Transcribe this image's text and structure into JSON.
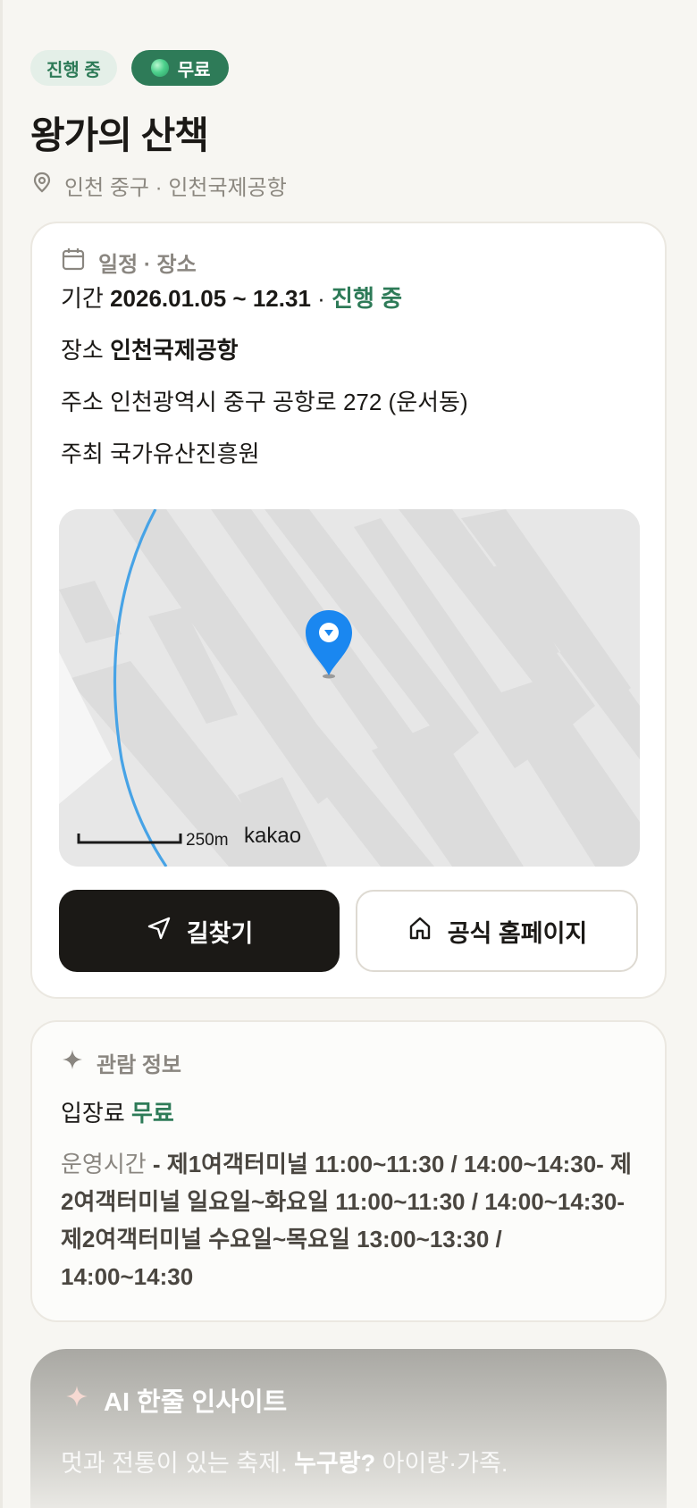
{
  "badges": {
    "status": "진행 중",
    "free": "무료"
  },
  "title": "왕가의 산책",
  "location": "인천 중구 · 인천국제공항",
  "schedule": {
    "heading": "일정 · 장소",
    "period_label": "기간",
    "period_value": "2026.01.05 ~ 12.31",
    "period_sep": "·",
    "period_status": "진행 중",
    "venue_label": "장소",
    "venue_value": "인천국제공항",
    "address_label": "주소",
    "address_value": "인천광역시 중구 공항로 272 (운서동)",
    "host_label": "주최",
    "host_value": "국가유산진흥원"
  },
  "map": {
    "scale_label": "250m",
    "brand": "kakao"
  },
  "actions": {
    "directions": "길찾기",
    "homepage": "공식 홈페이지"
  },
  "viewing": {
    "heading": "관람 정보",
    "fee_label": "입장료",
    "fee_value": "무료",
    "hours_label": "운영시간",
    "hours_value": "- 제1여객터미널 11:00~11:30 / 14:00~14:30- 제2여객터미널 일요일~화요일 11:00~11:30 / 14:00~14:30- 제2여객터미널 수요일~목요일 13:00~13:30 / 14:00~14:30"
  },
  "ai": {
    "heading": "AI 한줄 인사이트",
    "text_a": "멋과 전통이 있는 축제.",
    "text_b": "누구랑?",
    "text_c": "아이랑·가족."
  },
  "colors": {
    "accent": "#2e7b58",
    "dark": "#1b1916",
    "muted": "#8a8680",
    "pin": "#1a87f0",
    "route": "#47a3e6"
  },
  "icons": {
    "location": "map-pin-icon",
    "calendar": "calendar-icon",
    "sparkle": "sparkle-icon",
    "navigate": "navigation-arrow-icon",
    "home": "home-icon"
  }
}
